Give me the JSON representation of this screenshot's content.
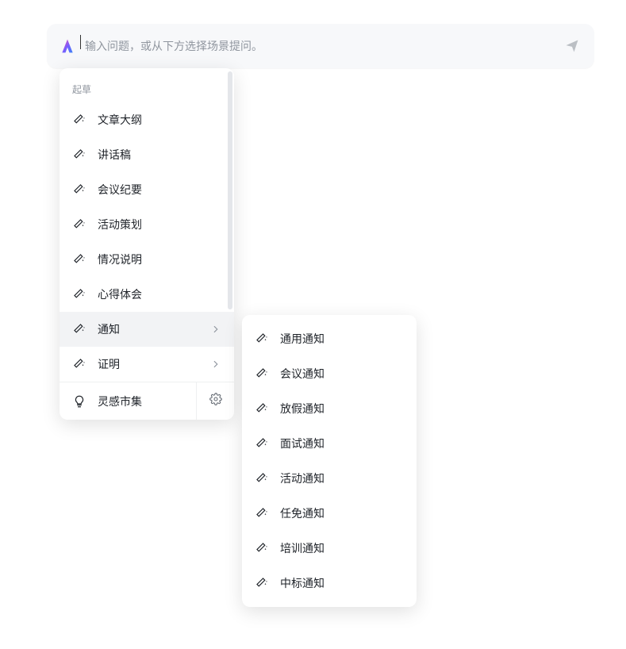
{
  "input": {
    "placeholder": "输入问题，或从下方选择场景提问。",
    "value": ""
  },
  "dropdown": {
    "section_label": "起草",
    "items": [
      {
        "label": "文章大纲",
        "has_sub": false
      },
      {
        "label": "讲话稿",
        "has_sub": false
      },
      {
        "label": "会议纪要",
        "has_sub": false
      },
      {
        "label": "活动策划",
        "has_sub": false
      },
      {
        "label": "情况说明",
        "has_sub": false
      },
      {
        "label": "心得体会",
        "has_sub": false
      },
      {
        "label": "通知",
        "has_sub": true,
        "active": true
      },
      {
        "label": "证明",
        "has_sub": true
      }
    ],
    "footer_label": "灵感市集"
  },
  "submenu": {
    "items": [
      {
        "label": "通用通知"
      },
      {
        "label": "会议通知"
      },
      {
        "label": "放假通知"
      },
      {
        "label": "面试通知"
      },
      {
        "label": "活动通知"
      },
      {
        "label": "任免通知"
      },
      {
        "label": "培训通知"
      },
      {
        "label": "中标通知"
      }
    ]
  }
}
